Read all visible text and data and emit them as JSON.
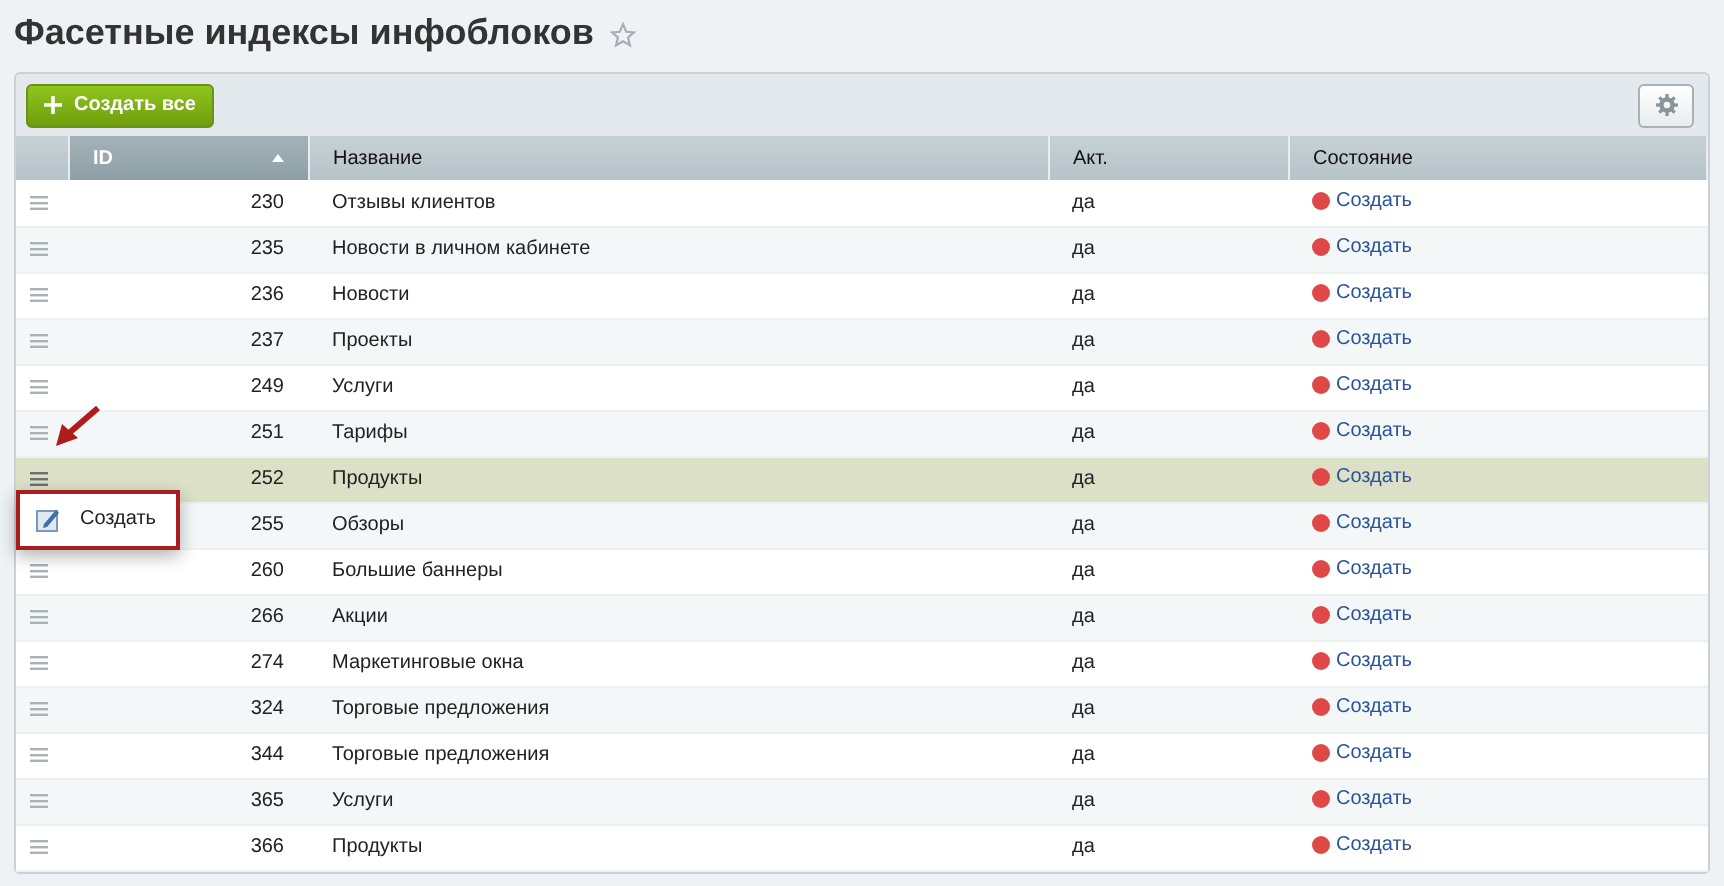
{
  "page": {
    "title": "Фасетные индексы инфоблоков"
  },
  "toolbar": {
    "create_all_button": "Создать все"
  },
  "table": {
    "columns": [
      {
        "label": "ID",
        "sorted": true
      },
      {
        "label": "Название",
        "sorted": false
      },
      {
        "label": "Акт.",
        "sorted": false
      },
      {
        "label": "Состояние",
        "sorted": false
      }
    ],
    "rows": [
      {
        "id": "230",
        "name": "Отзывы клиентов",
        "active": "да",
        "status": "Создать",
        "selected": false
      },
      {
        "id": "235",
        "name": "Новости в личном кабинете",
        "active": "да",
        "status": "Создать",
        "selected": false
      },
      {
        "id": "236",
        "name": "Новости",
        "active": "да",
        "status": "Создать",
        "selected": false
      },
      {
        "id": "237",
        "name": "Проекты",
        "active": "да",
        "status": "Создать",
        "selected": false
      },
      {
        "id": "249",
        "name": "Услуги",
        "active": "да",
        "status": "Создать",
        "selected": false
      },
      {
        "id": "251",
        "name": "Тарифы",
        "active": "да",
        "status": "Создать",
        "selected": false
      },
      {
        "id": "252",
        "name": "Продукты",
        "active": "да",
        "status": "Создать",
        "selected": true,
        "menu": {
          "items": [
            {
              "label": "Создать"
            }
          ]
        }
      },
      {
        "id": "255",
        "name": "Обзоры",
        "active": "да",
        "status": "Создать",
        "selected": false
      },
      {
        "id": "260",
        "name": "Большие баннеры",
        "active": "да",
        "status": "Создать",
        "selected": false
      },
      {
        "id": "266",
        "name": "Акции",
        "active": "да",
        "status": "Создать",
        "selected": false
      },
      {
        "id": "274",
        "name": "Маркетинговые окна",
        "active": "да",
        "status": "Создать",
        "selected": false
      },
      {
        "id": "324",
        "name": "Торговые предложения",
        "active": "да",
        "status": "Создать",
        "selected": false
      },
      {
        "id": "344",
        "name": "Торговые предложения",
        "active": "да",
        "status": "Создать",
        "selected": false
      },
      {
        "id": "365",
        "name": "Услуги",
        "active": "да",
        "status": "Создать",
        "selected": false
      },
      {
        "id": "366",
        "name": "Продукты",
        "active": "да",
        "status": "Создать",
        "selected": false
      }
    ]
  }
}
